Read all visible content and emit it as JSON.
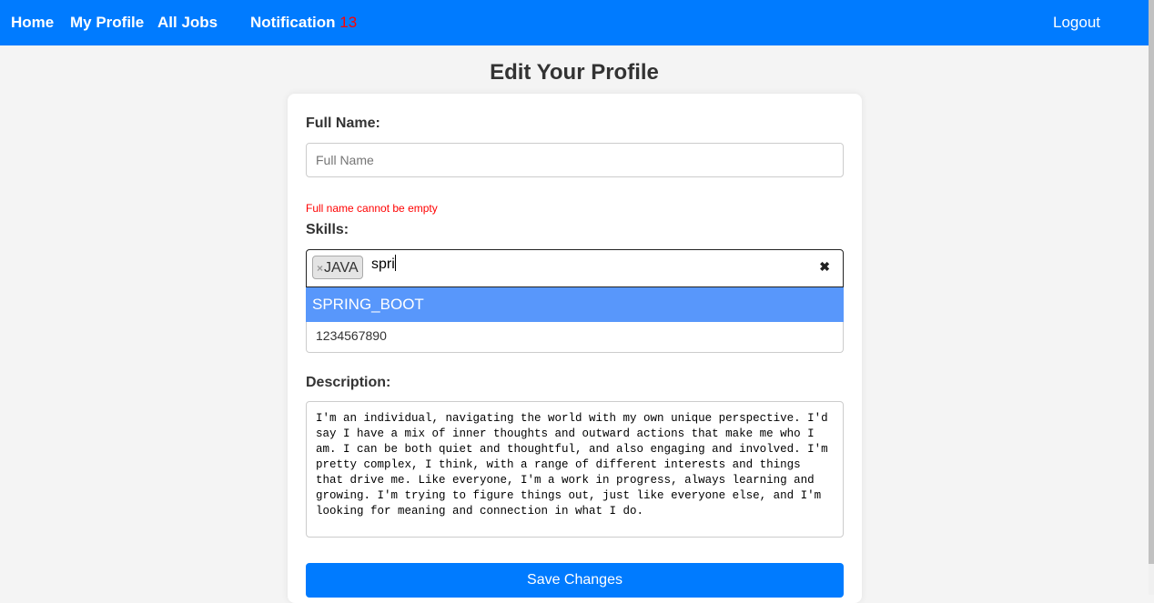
{
  "nav": {
    "home": "Home",
    "profile": "My Profile",
    "jobs": "All Jobs",
    "notification": "Notification",
    "notification_count": "13",
    "logout": "Logout"
  },
  "page_title": "Edit Your Profile",
  "form": {
    "full_name_label": "Full Name:",
    "full_name_value": "",
    "full_name_placeholder": "Full Name",
    "full_name_error": "Full name cannot be empty",
    "skills_label": "Skills:",
    "skills_selected": [
      "JAVA"
    ],
    "skills_search": "spri",
    "skills_dropdown_options": [
      "SPRING_BOOT"
    ],
    "phone_value": "1234567890",
    "description_label": "Description:",
    "description_value": "I'm an individual, navigating the world with my own unique perspective. I'd say I have a mix of inner thoughts and outward actions that make me who I am. I can be both quiet and thoughtful, and also engaging and involved. I'm pretty complex, I think, with a range of different interests and things that drive me. Like everyone, I'm a work in progress, always learning and growing. I'm trying to figure things out, just like everyone else, and I'm looking for meaning and connection in what I do.",
    "save_label": "Save Changes"
  },
  "colors": {
    "primary": "#007bff",
    "error": "#ff0000",
    "highlight": "#5897fb"
  }
}
